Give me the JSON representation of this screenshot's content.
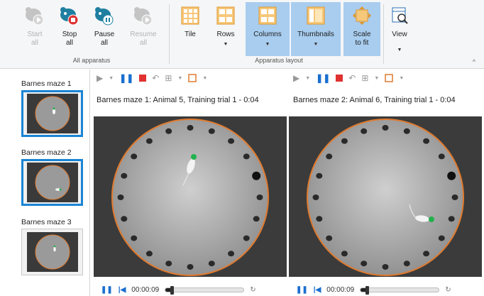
{
  "ribbon": {
    "buttons": [
      {
        "label": "Start\nall",
        "icon": "mouse-play-icon",
        "disabled": true
      },
      {
        "label": "Stop\nall",
        "icon": "mouse-stop-icon",
        "disabled": false
      },
      {
        "label": "Pause\nall",
        "icon": "mouse-pause-icon",
        "disabled": false
      },
      {
        "label": "Resume\nall",
        "icon": "mouse-resume-icon",
        "disabled": true
      },
      {
        "label": "Tile",
        "icon": "tile-grid-icon"
      },
      {
        "label": "Rows",
        "icon": "rows-layout-icon"
      },
      {
        "label": "Columns",
        "icon": "columns-layout-icon"
      },
      {
        "label": "Thumbnails",
        "icon": "thumbnails-icon"
      },
      {
        "label": "Scale\nto fit",
        "icon": "scale-to-fit-icon"
      },
      {
        "label": "View",
        "icon": "view-icon"
      }
    ],
    "groups": {
      "apparatus": "All apparatus",
      "layout": "Apparatus layout"
    }
  },
  "thumbnails": [
    {
      "label": "Barnes maze 1",
      "selected": true
    },
    {
      "label": "Barnes maze 2",
      "selected": true
    },
    {
      "label": "Barnes maze 3",
      "selected": false
    }
  ],
  "panes": [
    {
      "title": "Barnes maze 1: Animal 5, Training trial 1 - 0:04",
      "time": "00:00:09",
      "progress": 0.08
    },
    {
      "title": "Barnes maze 2: Animal 6, Training trial 1 - 0:04",
      "time": "00:00:09",
      "progress": 0.08
    }
  ],
  "colors": {
    "accent": "#1a84d4",
    "active_bg": "#a8cdef",
    "maze_rim": "#e07a2e",
    "stop_red": "#e03131",
    "target_green": "#22b14c"
  }
}
